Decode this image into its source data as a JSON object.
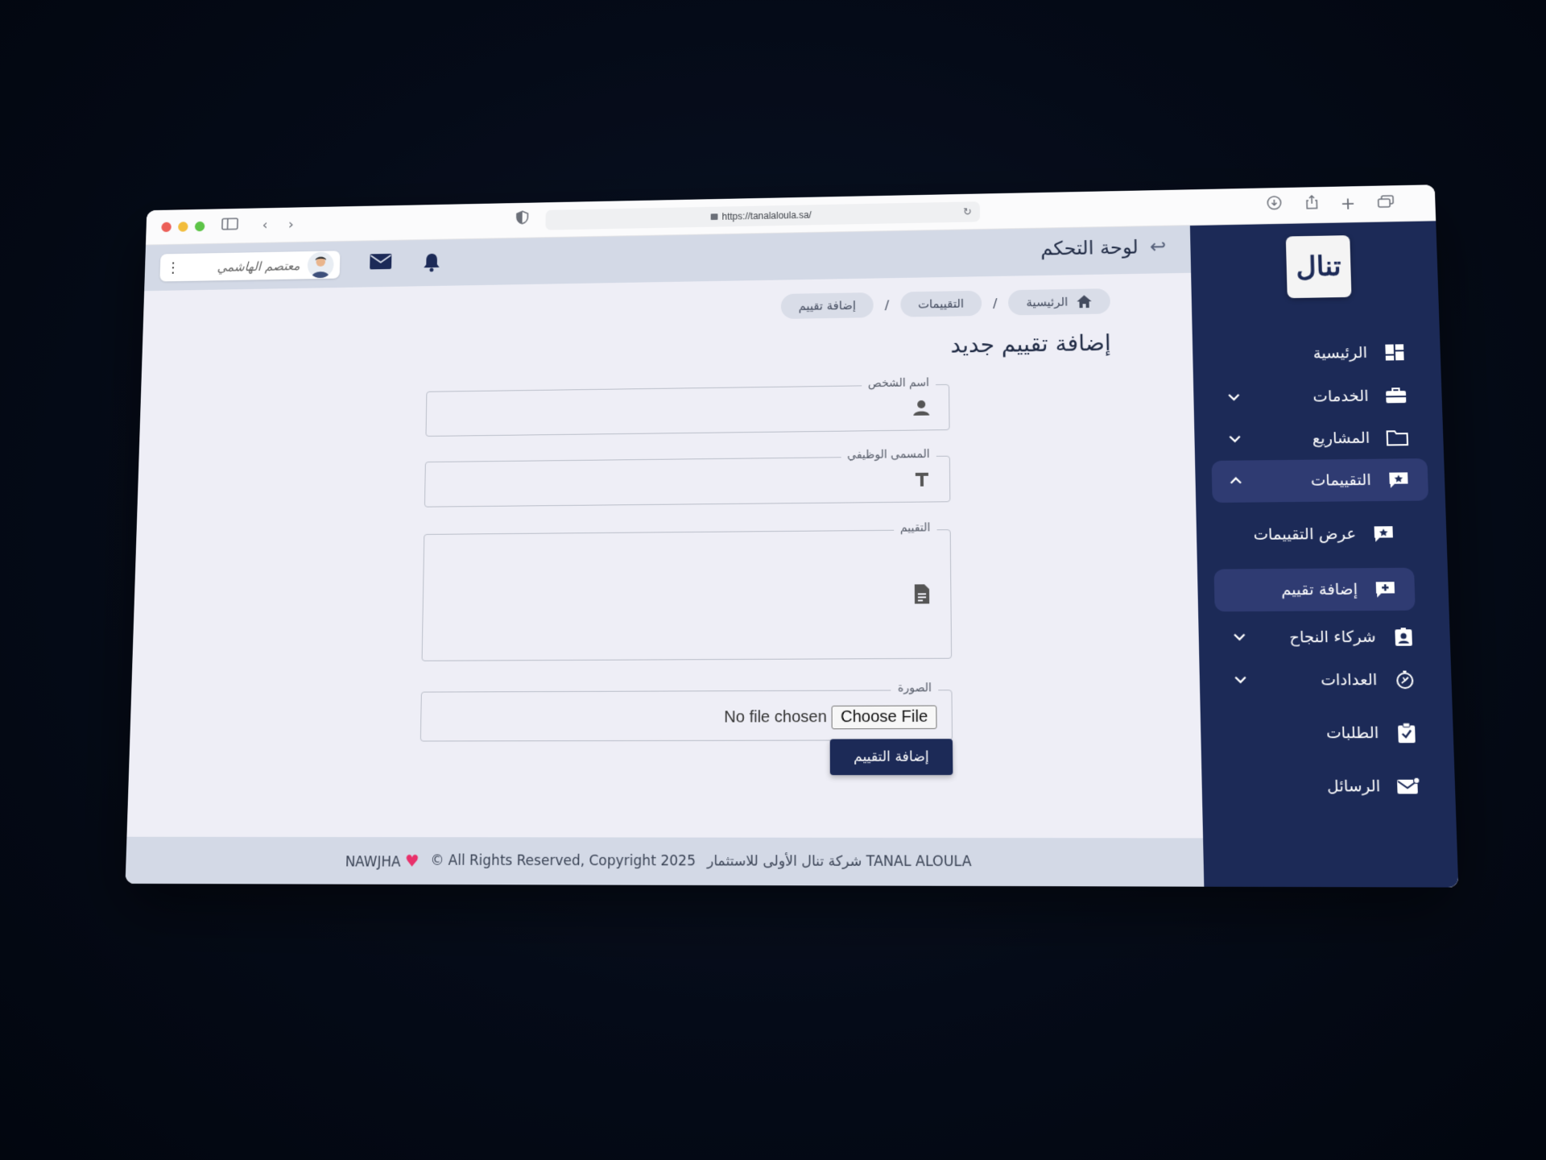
{
  "browser": {
    "url": "https://tanalaloula.sa/"
  },
  "topbar": {
    "dashboard_title": "لوحة التحكم",
    "user_name": "معتصم الهاشمي"
  },
  "breadcrumb": [
    {
      "label": "الرئيسية"
    },
    {
      "label": "التقييمات"
    },
    {
      "label": "إضافة تقييم"
    }
  ],
  "breadcrumb_separator": "/",
  "page": {
    "title": "إضافة تقييم جديد"
  },
  "form": {
    "person_name_label": "اسم الشخص",
    "job_title_label": "المسمى الوظيفي",
    "review_label": "التقييم",
    "image_label": "الصورة",
    "choose_file": "Choose File",
    "no_file": "No file chosen",
    "submit_label": "إضافة التقييم"
  },
  "sidebar": {
    "logo_text": "تنال",
    "items": [
      {
        "label": "الرئيسية",
        "icon": "dashboard-icon"
      },
      {
        "label": "الخدمات",
        "icon": "toolbox-icon"
      },
      {
        "label": "المشاريع",
        "icon": "folder-icon"
      },
      {
        "label": "التقييمات",
        "icon": "review-icon"
      },
      {
        "label": "عرض التقييمات",
        "icon": "review-icon"
      },
      {
        "label": "إضافة تقييم",
        "icon": "add-review-icon"
      },
      {
        "label": "شركاء النجاح",
        "icon": "contact-badge-icon"
      },
      {
        "label": "العدادات",
        "icon": "counter-icon"
      },
      {
        "label": "الطلبات",
        "icon": "clipboard-check-icon"
      },
      {
        "label": "الرسائل",
        "icon": "mail-icon"
      }
    ]
  },
  "footer": {
    "company": "شركة تنال الأولى للاستثمار TANAL ALOULA",
    "copyright": "© All Rights Reserved, Copyright 2025",
    "credit": "NAWJHA"
  },
  "colors": {
    "sidebar": "#1c2a57",
    "accent": "#1c2a57",
    "background": "#eeeef6",
    "topbar": "#d3d9e6"
  }
}
